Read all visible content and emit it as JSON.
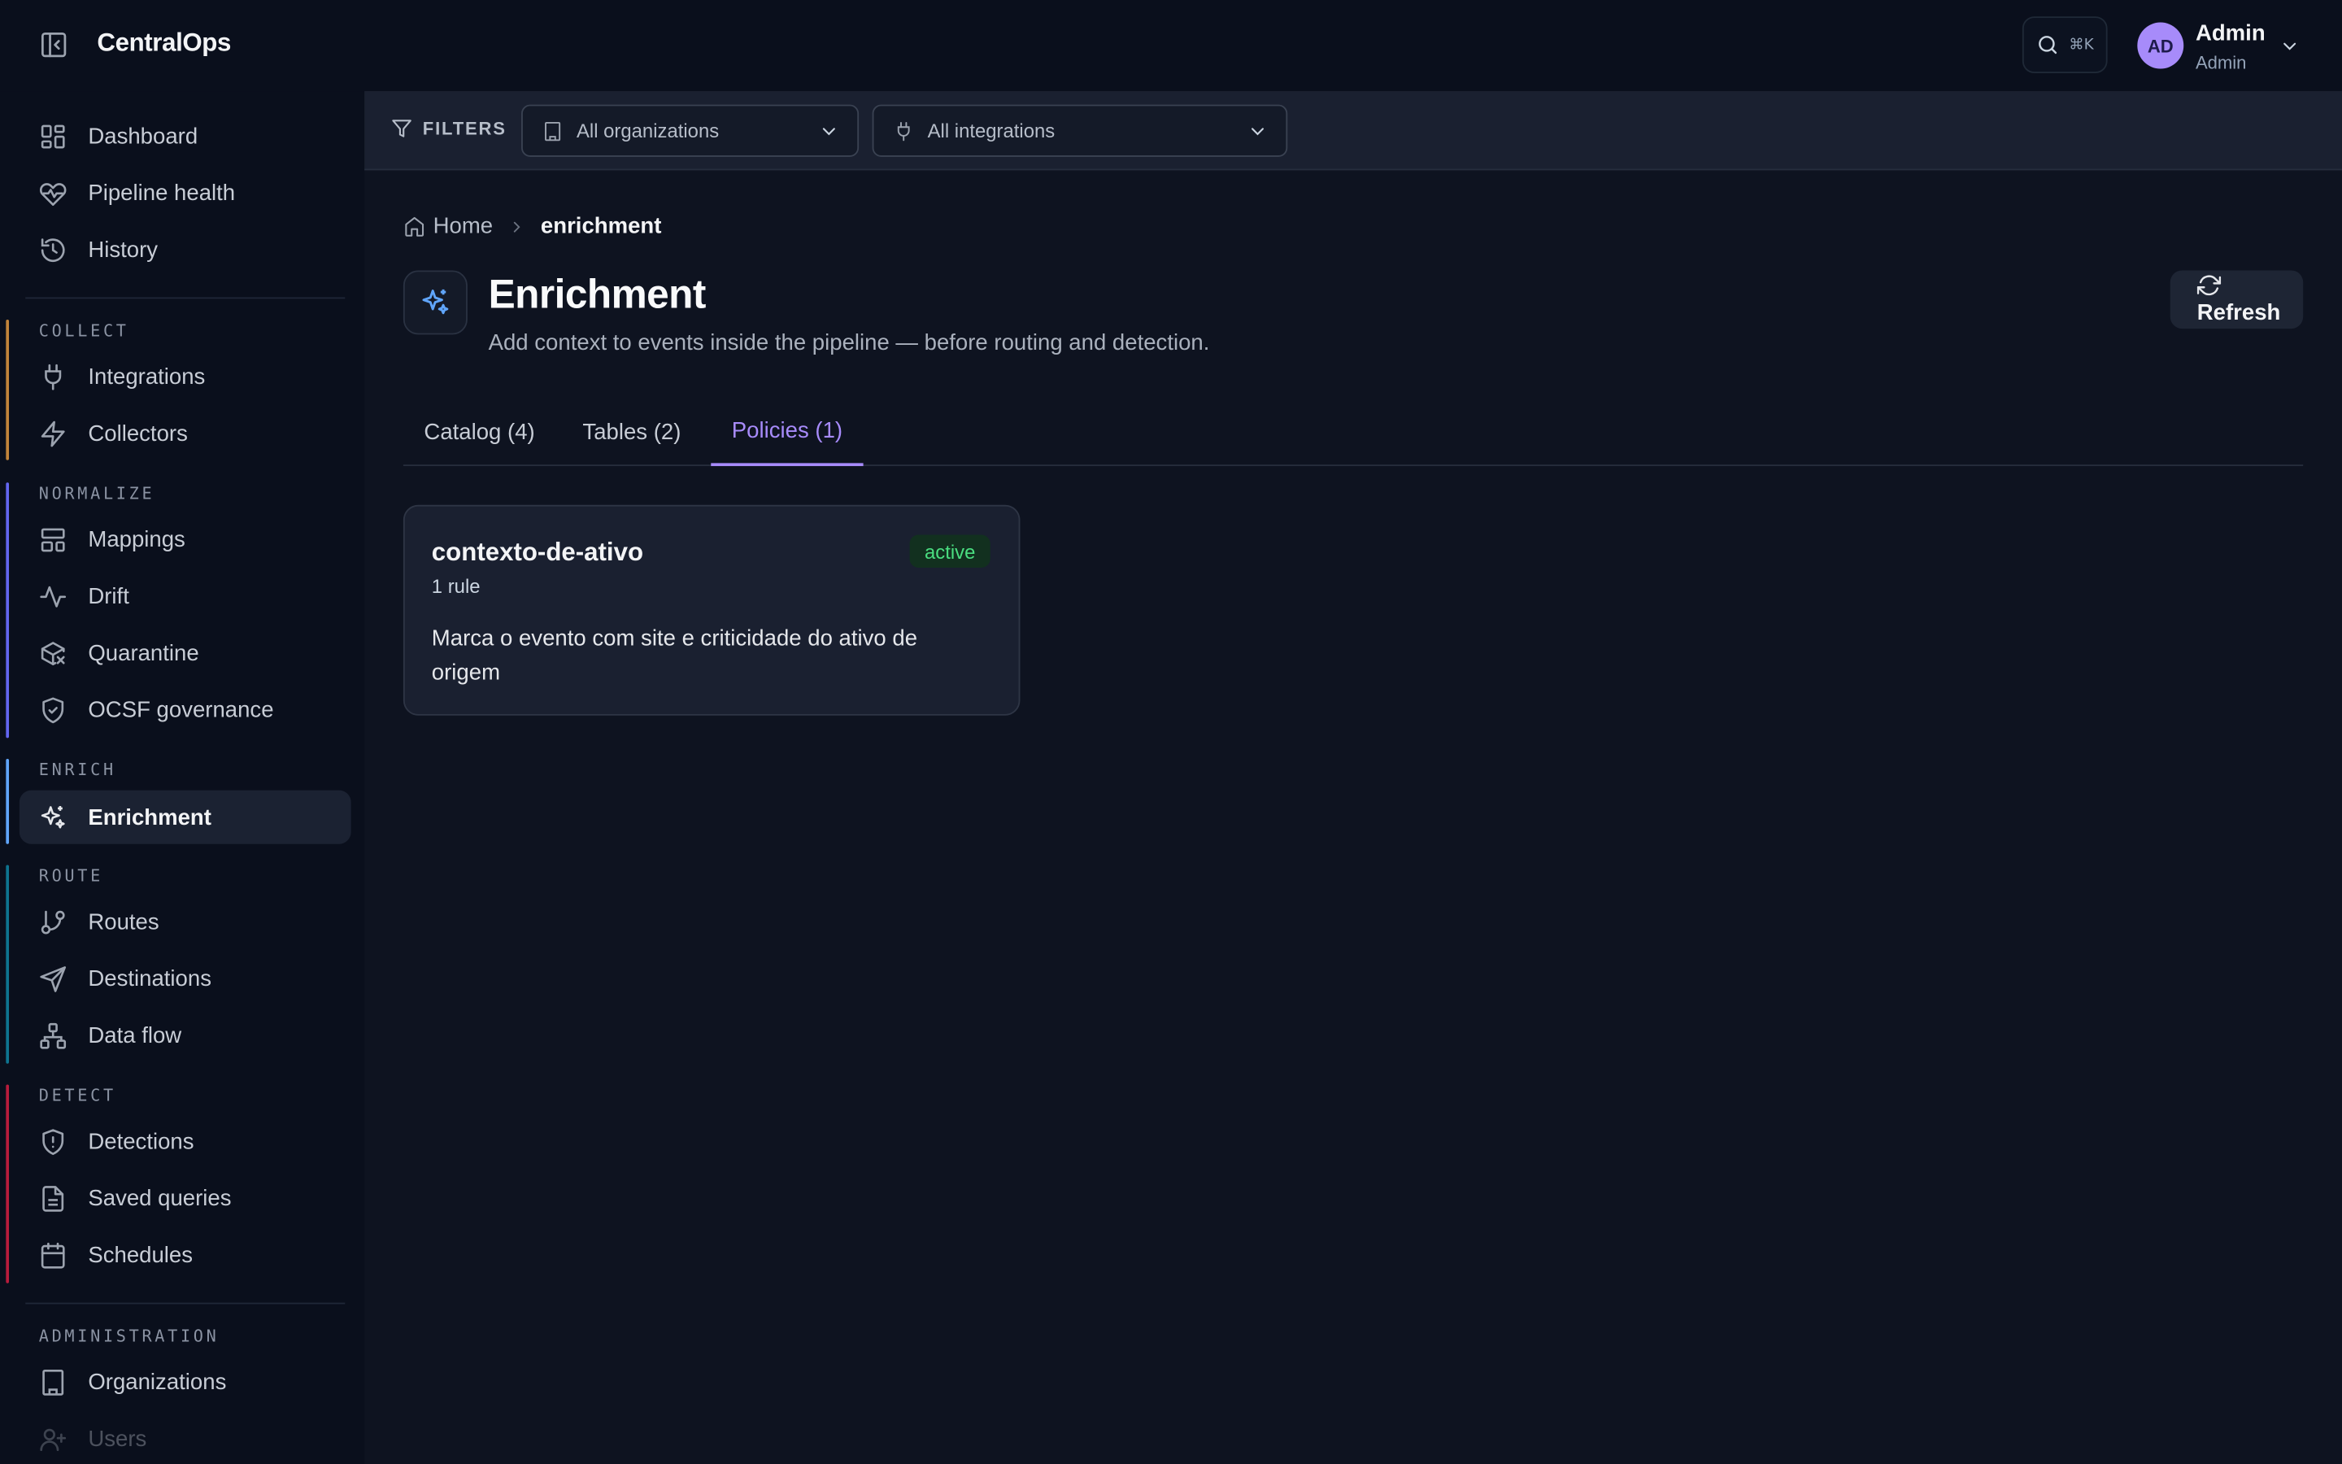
{
  "app": {
    "brand": "CentralOps"
  },
  "header": {
    "search_shortcut": "⌘K",
    "user": {
      "initials": "AD",
      "name": "Admin",
      "role": "Admin"
    }
  },
  "sidebar": {
    "top_items": [
      {
        "label": "Dashboard",
        "icon": "dashboard-icon"
      },
      {
        "label": "Pipeline health",
        "icon": "heart-pulse-icon"
      },
      {
        "label": "History",
        "icon": "history-icon"
      }
    ],
    "sections": [
      {
        "label": "COLLECT",
        "accent": "#c2843a",
        "items": [
          {
            "label": "Integrations",
            "icon": "plug-icon"
          },
          {
            "label": "Collectors",
            "icon": "bolt-icon"
          }
        ]
      },
      {
        "label": "NORMALIZE",
        "accent": "#6366f1",
        "items": [
          {
            "label": "Mappings",
            "icon": "layout-icon"
          },
          {
            "label": "Drift",
            "icon": "activity-icon"
          },
          {
            "label": "Quarantine",
            "icon": "package-x-icon"
          },
          {
            "label": "OCSF governance",
            "icon": "shield-check-icon"
          }
        ]
      },
      {
        "label": "ENRICH",
        "accent": "#60a5fa",
        "items": [
          {
            "label": "Enrichment",
            "icon": "sparkles-icon"
          }
        ]
      },
      {
        "label": "ROUTE",
        "accent": "#0e7490",
        "items": [
          {
            "label": "Routes",
            "icon": "git-branch-icon"
          },
          {
            "label": "Destinations",
            "icon": "send-icon"
          },
          {
            "label": "Data flow",
            "icon": "network-icon"
          }
        ]
      },
      {
        "label": "DETECT",
        "accent": "#b91c3c",
        "items": [
          {
            "label": "Detections",
            "icon": "shield-alert-icon"
          },
          {
            "label": "Saved queries",
            "icon": "file-text-icon"
          },
          {
            "label": "Schedules",
            "icon": "calendar-icon"
          }
        ]
      },
      {
        "label": "ADMINISTRATION",
        "accent": "",
        "items": [
          {
            "label": "Organizations",
            "icon": "building-icon"
          },
          {
            "label": "Users",
            "icon": "user-plus-icon"
          }
        ]
      }
    ]
  },
  "filters": {
    "label": "FILTERS",
    "organizations": {
      "value": "All organizations"
    },
    "integrations": {
      "value": "All integrations"
    }
  },
  "breadcrumb": {
    "home": "Home",
    "current": "enrichment"
  },
  "page": {
    "title": "Enrichment",
    "subtitle": "Add context to events inside the pipeline — before routing and detection.",
    "refresh_label": "Refresh"
  },
  "tabs": [
    {
      "label": "Catalog (4)",
      "active": false
    },
    {
      "label": "Tables (2)",
      "active": false
    },
    {
      "label": "Policies (1)",
      "active": true
    }
  ],
  "policies": [
    {
      "name": "contexto-de-ativo",
      "rules": "1 rule",
      "status": "active",
      "description": "Marca o evento com site e criticidade do ativo de origem"
    }
  ],
  "colors": {
    "accent": "#a78bfa",
    "status_active": "#4ade80",
    "enrich_icon": "#60a5fa"
  }
}
